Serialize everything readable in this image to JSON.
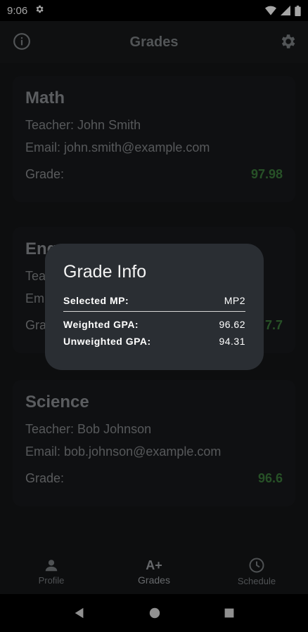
{
  "status_bar": {
    "time": "9:06"
  },
  "app_bar": {
    "title": "Grades"
  },
  "cards": [
    {
      "subject": "Math",
      "teacher": "Teacher: John Smith",
      "email": "Email: john.smith@example.com",
      "grade_label": "Grade:",
      "grade": "97.98"
    },
    {
      "subject": "Eng",
      "teacher": "Tea",
      "email": "Em",
      "grade_label": "Gra",
      "grade": "7.7"
    },
    {
      "subject": "Science",
      "teacher": "Teacher: Bob Johnson",
      "email": "Email: bob.johnson@example.com",
      "grade_label": "Grade:",
      "grade": "96.6"
    }
  ],
  "dialog": {
    "title": "Grade Info",
    "selected_mp_label": "Selected MP:",
    "selected_mp_value": "MP2",
    "weighted_label": "Weighted GPA:",
    "weighted_value": "96.62",
    "unweighted_label": "Unweighted GPA:",
    "unweighted_value": "94.31"
  },
  "bottom_nav": {
    "items": [
      {
        "label": "Profile",
        "icon": "person-icon"
      },
      {
        "label": "Grades",
        "icon": "a-plus-icon",
        "glyph": "A+"
      },
      {
        "label": "Schedule",
        "icon": "clock-icon"
      }
    ]
  },
  "colors": {
    "grade_green": "#3c7d3c",
    "dialog_bg": "#2a2e33",
    "background": "#141618"
  }
}
